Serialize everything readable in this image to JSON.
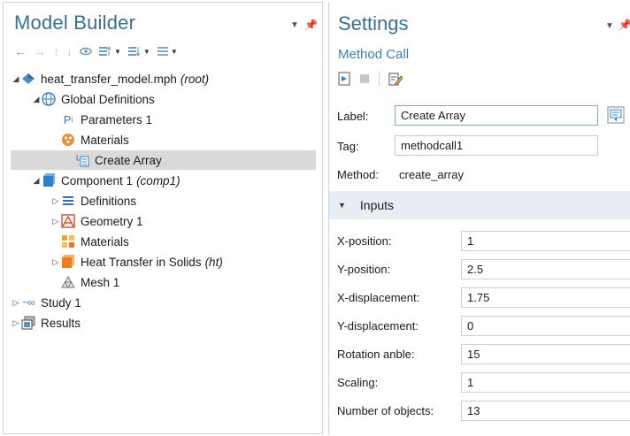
{
  "model_builder": {
    "title": "Model Builder",
    "tree": {
      "root": {
        "label": "heat_transfer_model.mph",
        "tag": "(root)"
      },
      "global_definitions": "Global Definitions",
      "parameters": "Parameters 1",
      "materials_global": "Materials",
      "create_array": "Create Array",
      "component": {
        "label": "Component 1",
        "tag": "(comp1)"
      },
      "definitions": "Definitions",
      "geometry": "Geometry 1",
      "materials_comp": "Materials",
      "heat_transfer": {
        "label": "Heat Transfer in Solids",
        "tag": "(ht)"
      },
      "mesh": "Mesh 1",
      "study": "Study 1",
      "results": "Results"
    }
  },
  "settings": {
    "title": "Settings",
    "subtitle": "Method Call",
    "label_label": "Label:",
    "label_value": "Create Array",
    "tag_label": "Tag:",
    "tag_value": "methodcall1",
    "method_label": "Method:",
    "method_value": "create_array",
    "section_title": "Inputs",
    "inputs": [
      {
        "label": "X-position:",
        "value": "1"
      },
      {
        "label": "Y-position:",
        "value": "2.5"
      },
      {
        "label": "X-displacement:",
        "value": "1.75"
      },
      {
        "label": "Y-displacement:",
        "value": "0"
      },
      {
        "label": "Rotation anble:",
        "value": "15"
      },
      {
        "label": "Scaling:",
        "value": "1"
      },
      {
        "label": "Number of objects:",
        "value": "13"
      }
    ]
  },
  "colors": {
    "title_blue": "#3d6e8f",
    "selection_gray": "#d9d9d9",
    "section_bg": "#e8eef4"
  }
}
